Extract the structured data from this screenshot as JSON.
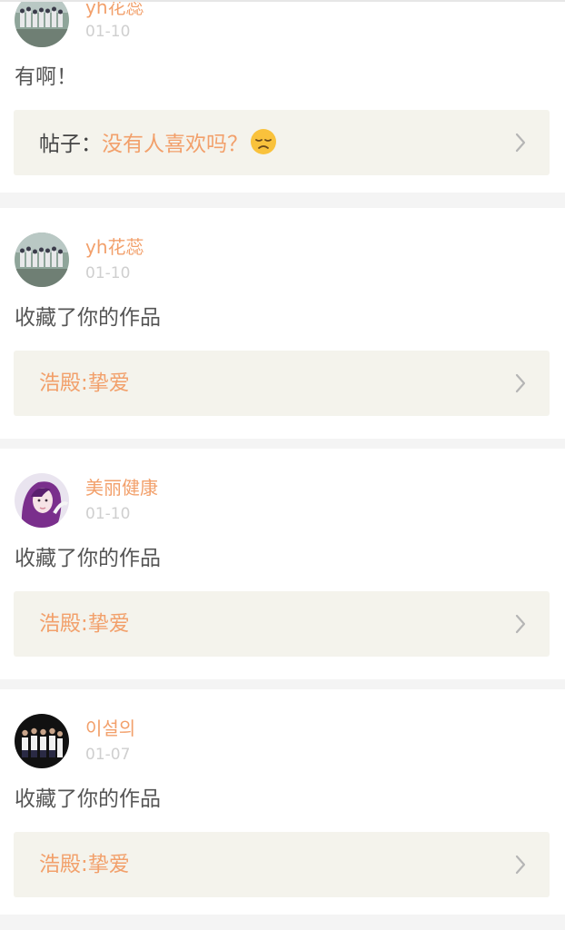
{
  "notifications": [
    {
      "username": "yh花蕊",
      "date": "01-10",
      "message": "有啊！",
      "link_prefix": "帖子：",
      "link_title": "没有人喜欢吗？",
      "emoji_icon": "disappointed-face-emoji"
    },
    {
      "username": "yh花蕊",
      "date": "01-10",
      "message": "收藏了你的作品",
      "link_prefix": "",
      "link_title": "浩殿:挚爱"
    },
    {
      "username": "美丽健康",
      "date": "01-10",
      "message": "收藏了你的作品",
      "link_prefix": "",
      "link_title": "浩殿:挚爱"
    },
    {
      "username": "이설의",
      "date": "01-07",
      "message": "收藏了你的作品",
      "link_prefix": "",
      "link_title": "浩殿:挚爱"
    }
  ],
  "colors": {
    "accent": "#f2a06b",
    "page_background": "#f4f4f4",
    "link_box_background": "#f4f3ec",
    "date_text": "#cfcfcf"
  }
}
